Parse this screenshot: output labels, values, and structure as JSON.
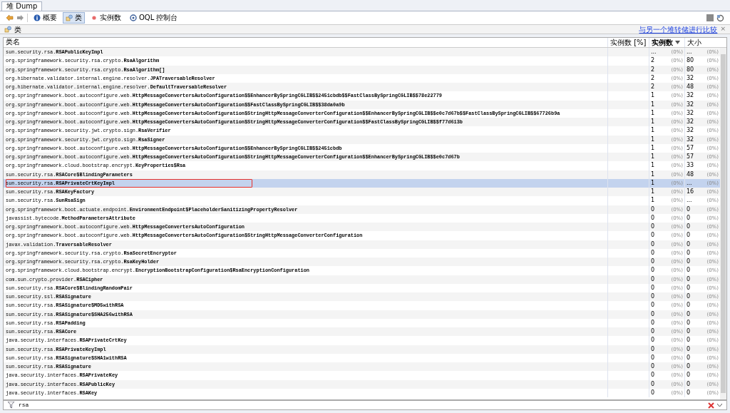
{
  "tab": {
    "label": "堆 Dump"
  },
  "toolbar": {
    "buttons": [
      {
        "label": "概要",
        "kind": "info",
        "selected": false
      },
      {
        "label": "类",
        "kind": "classes",
        "selected": true
      },
      {
        "label": "实例数",
        "kind": "instances",
        "selected": false
      },
      {
        "label": "OQL 控制台",
        "kind": "oql",
        "selected": false
      }
    ]
  },
  "panel": {
    "title": "类",
    "compare_link": "与另一个堆转储进行比较",
    "close": "×"
  },
  "table": {
    "columns": [
      {
        "label": "类名",
        "sorted": false
      },
      {
        "label": "实例数 [%]",
        "sorted": false
      },
      {
        "label": "实例数",
        "sorted": true
      },
      {
        "label": "大小",
        "sorted": false
      }
    ],
    "rows": [
      {
        "name": "sun.security.rsa.**RSAPublicKeyImpl**",
        "count": "...",
        "count_pct": "(0%)",
        "size": "...",
        "size_pct": "(0%)",
        "selected": false,
        "boxed": false
      },
      {
        "name": "org.springframework.security.rsa.crypto.**RsaAlgorithm**",
        "count": "2",
        "count_pct": "(0%)",
        "size": "80",
        "size_pct": "(0%)",
        "selected": false,
        "boxed": false
      },
      {
        "name": "org.springframework.security.rsa.crypto.**RsaAlgorithm[]**",
        "count": "2",
        "count_pct": "(0%)",
        "size": "80",
        "size_pct": "(0%)",
        "selected": false,
        "boxed": false
      },
      {
        "name": "org.hibernate.validator.internal.engine.resolver.**JPATraversableResolver**",
        "count": "2",
        "count_pct": "(0%)",
        "size": "32",
        "size_pct": "(0%)",
        "selected": false,
        "boxed": false
      },
      {
        "name": "org.hibernate.validator.internal.engine.resolver.**DefaultTraversableResolver**",
        "count": "2",
        "count_pct": "(0%)",
        "size": "48",
        "size_pct": "(0%)",
        "selected": false,
        "boxed": false
      },
      {
        "name": "org.springframework.boot.autoconfigure.web.**HttpMessageConvertersAutoConfiguration$$EnhancerBySpringCGLIB$$2451cbdb$$FastClassBySpringCGLIB$$78e22779**",
        "count": "1",
        "count_pct": "(0%)",
        "size": "32",
        "size_pct": "(0%)",
        "selected": false,
        "boxed": false
      },
      {
        "name": "org.springframework.boot.autoconfigure.web.**HttpMessageConvertersAutoConfiguration$$FastClassBySpringCGLIB$$38da0a9b**",
        "count": "1",
        "count_pct": "(0%)",
        "size": "32",
        "size_pct": "(0%)",
        "selected": false,
        "boxed": false
      },
      {
        "name": "org.springframework.boot.autoconfigure.web.**HttpMessageConvertersAutoConfiguration$StringHttpMessageConverterConfiguration$$EnhancerBySpringCGLIB$$e0c7d67b$$FastClassBySpringCGLIB$$67726b9a**",
        "count": "1",
        "count_pct": "(0%)",
        "size": "32",
        "size_pct": "(0%)",
        "selected": false,
        "boxed": false
      },
      {
        "name": "org.springframework.boot.autoconfigure.web.**HttpMessageConvertersAutoConfiguration$StringHttpMessageConverterConfiguration$$FastClassBySpringCGLIB$$f77d613b**",
        "count": "1",
        "count_pct": "(0%)",
        "size": "32",
        "size_pct": "(0%)",
        "selected": false,
        "boxed": false
      },
      {
        "name": "org.springframework.security.jwt.crypto.sign.**RsaVerifier**",
        "count": "1",
        "count_pct": "(0%)",
        "size": "32",
        "size_pct": "(0%)",
        "selected": false,
        "boxed": false
      },
      {
        "name": "org.springframework.security.jwt.crypto.sign.**RsaSigner**",
        "count": "1",
        "count_pct": "(0%)",
        "size": "32",
        "size_pct": "(0%)",
        "selected": false,
        "boxed": false
      },
      {
        "name": "org.springframework.boot.autoconfigure.web.**HttpMessageConvertersAutoConfiguration$$EnhancerBySpringCGLIB$$2451cbdb**",
        "count": "1",
        "count_pct": "(0%)",
        "size": "57",
        "size_pct": "(0%)",
        "selected": false,
        "boxed": false
      },
      {
        "name": "org.springframework.boot.autoconfigure.web.**HttpMessageConvertersAutoConfiguration$StringHttpMessageConverterConfiguration$$EnhancerBySpringCGLIB$$e0c7d67b**",
        "count": "1",
        "count_pct": "(0%)",
        "size": "57",
        "size_pct": "(0%)",
        "selected": false,
        "boxed": false
      },
      {
        "name": "org.springframework.cloud.bootstrap.encrypt.**KeyProperties$Rsa**",
        "count": "1",
        "count_pct": "(0%)",
        "size": "33",
        "size_pct": "(0%)",
        "selected": false,
        "boxed": false
      },
      {
        "name": "sun.security.rsa.**RSACore$BlindingParameters**",
        "count": "1",
        "count_pct": "(0%)",
        "size": "48",
        "size_pct": "(0%)",
        "selected": false,
        "boxed": false
      },
      {
        "name": "sun.security.rsa.**RSAPrivateCrtKeyImpl**",
        "count": "1",
        "count_pct": "(0%)",
        "size": "...",
        "size_pct": "(0%)",
        "selected": true,
        "boxed": true
      },
      {
        "name": "sun.security.rsa.**RSAKeyFactory**",
        "count": "1",
        "count_pct": "(0%)",
        "size": "16",
        "size_pct": "(0%)",
        "selected": false,
        "boxed": false
      },
      {
        "name": "sun.security.rsa.**SunRsaSign**",
        "count": "1",
        "count_pct": "(0%)",
        "size": "...",
        "size_pct": "(0%)",
        "selected": false,
        "boxed": false
      },
      {
        "name": "org.springframework.boot.actuate.endpoint.**EnvironmentEndpoint$PlaceholderSanitizingPropertyResolver**",
        "count": "0",
        "count_pct": "(0%)",
        "size": "0",
        "size_pct": "(0%)",
        "selected": false,
        "boxed": false
      },
      {
        "name": "javassist.bytecode.**MethodParametersAttribute**",
        "count": "0",
        "count_pct": "(0%)",
        "size": "0",
        "size_pct": "(0%)",
        "selected": false,
        "boxed": false
      },
      {
        "name": "org.springframework.boot.autoconfigure.web.**HttpMessageConvertersAutoConfiguration**",
        "count": "0",
        "count_pct": "(0%)",
        "size": "0",
        "size_pct": "(0%)",
        "selected": false,
        "boxed": false
      },
      {
        "name": "org.springframework.boot.autoconfigure.web.**HttpMessageConvertersAutoConfiguration$StringHttpMessageConverterConfiguration**",
        "count": "0",
        "count_pct": "(0%)",
        "size": "0",
        "size_pct": "(0%)",
        "selected": false,
        "boxed": false
      },
      {
        "name": "javax.validation.**TraversableResolver**",
        "count": "0",
        "count_pct": "(0%)",
        "size": "0",
        "size_pct": "(0%)",
        "selected": false,
        "boxed": false
      },
      {
        "name": "org.springframework.security.rsa.crypto.**RsaSecretEncryptor**",
        "count": "0",
        "count_pct": "(0%)",
        "size": "0",
        "size_pct": "(0%)",
        "selected": false,
        "boxed": false
      },
      {
        "name": "org.springframework.security.rsa.crypto.**RsaKeyHolder**",
        "count": "0",
        "count_pct": "(0%)",
        "size": "0",
        "size_pct": "(0%)",
        "selected": false,
        "boxed": false
      },
      {
        "name": "org.springframework.cloud.bootstrap.encrypt.**EncryptionBootstrapConfiguration$RsaEncryptionConfiguration**",
        "count": "0",
        "count_pct": "(0%)",
        "size": "0",
        "size_pct": "(0%)",
        "selected": false,
        "boxed": false
      },
      {
        "name": "com.sun.crypto.provider.**RSACipher**",
        "count": "0",
        "count_pct": "(0%)",
        "size": "0",
        "size_pct": "(0%)",
        "selected": false,
        "boxed": false
      },
      {
        "name": "sun.security.rsa.**RSACore$BlindingRandomPair**",
        "count": "0",
        "count_pct": "(0%)",
        "size": "0",
        "size_pct": "(0%)",
        "selected": false,
        "boxed": false
      },
      {
        "name": "sun.security.ssl.**RSASignature**",
        "count": "0",
        "count_pct": "(0%)",
        "size": "0",
        "size_pct": "(0%)",
        "selected": false,
        "boxed": false
      },
      {
        "name": "sun.security.rsa.**RSASignature$MD5withRSA**",
        "count": "0",
        "count_pct": "(0%)",
        "size": "0",
        "size_pct": "(0%)",
        "selected": false,
        "boxed": false
      },
      {
        "name": "sun.security.rsa.**RSASignature$SHA256withRSA**",
        "count": "0",
        "count_pct": "(0%)",
        "size": "0",
        "size_pct": "(0%)",
        "selected": false,
        "boxed": false
      },
      {
        "name": "sun.security.rsa.**RSAPadding**",
        "count": "0",
        "count_pct": "(0%)",
        "size": "0",
        "size_pct": "(0%)",
        "selected": false,
        "boxed": false
      },
      {
        "name": "sun.security.rsa.**RSACore**",
        "count": "0",
        "count_pct": "(0%)",
        "size": "0",
        "size_pct": "(0%)",
        "selected": false,
        "boxed": false
      },
      {
        "name": "java.security.interfaces.**RSAPrivateCrtKey**",
        "count": "0",
        "count_pct": "(0%)",
        "size": "0",
        "size_pct": "(0%)",
        "selected": false,
        "boxed": false
      },
      {
        "name": "sun.security.rsa.**RSAPrivateKeyImpl**",
        "count": "0",
        "count_pct": "(0%)",
        "size": "0",
        "size_pct": "(0%)",
        "selected": false,
        "boxed": false
      },
      {
        "name": "sun.security.rsa.**RSASignature$SHA1withRSA**",
        "count": "0",
        "count_pct": "(0%)",
        "size": "0",
        "size_pct": "(0%)",
        "selected": false,
        "boxed": false
      },
      {
        "name": "sun.security.rsa.**RSASignature**",
        "count": "0",
        "count_pct": "(0%)",
        "size": "0",
        "size_pct": "(0%)",
        "selected": false,
        "boxed": false
      },
      {
        "name": "java.security.interfaces.**RSAPrivateKey**",
        "count": "0",
        "count_pct": "(0%)",
        "size": "0",
        "size_pct": "(0%)",
        "selected": false,
        "boxed": false
      },
      {
        "name": "java.security.interfaces.**RSAPublicKey**",
        "count": "0",
        "count_pct": "(0%)",
        "size": "0",
        "size_pct": "(0%)",
        "selected": false,
        "boxed": false
      },
      {
        "name": "java.security.interfaces.**RSAKey**",
        "count": "0",
        "count_pct": "(0%)",
        "size": "0",
        "size_pct": "(0%)",
        "selected": false,
        "boxed": false
      }
    ]
  },
  "filter": {
    "value": "rsa"
  }
}
